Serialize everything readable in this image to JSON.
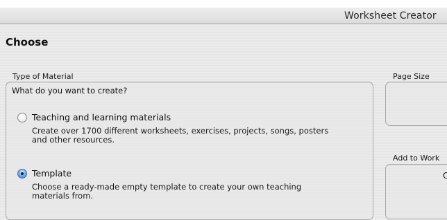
{
  "window": {
    "title": "Worksheet Creator"
  },
  "page": {
    "heading": "Choose"
  },
  "type_of_material": {
    "label": "Type of Material",
    "question": "What do you want to create?",
    "options": [
      {
        "label": "Teaching and learning materials",
        "description": "Create over 1700 different worksheets, exercises, projects, songs, posters and other resources.",
        "selected": false
      },
      {
        "label": "Template",
        "description": "Choose a ready-made empty template to create your own teaching materials from.",
        "selected": true
      }
    ]
  },
  "page_size": {
    "label": "Page Size"
  },
  "add_to_worksheet": {
    "label": "Add to Work",
    "content_fragment": "O"
  }
}
